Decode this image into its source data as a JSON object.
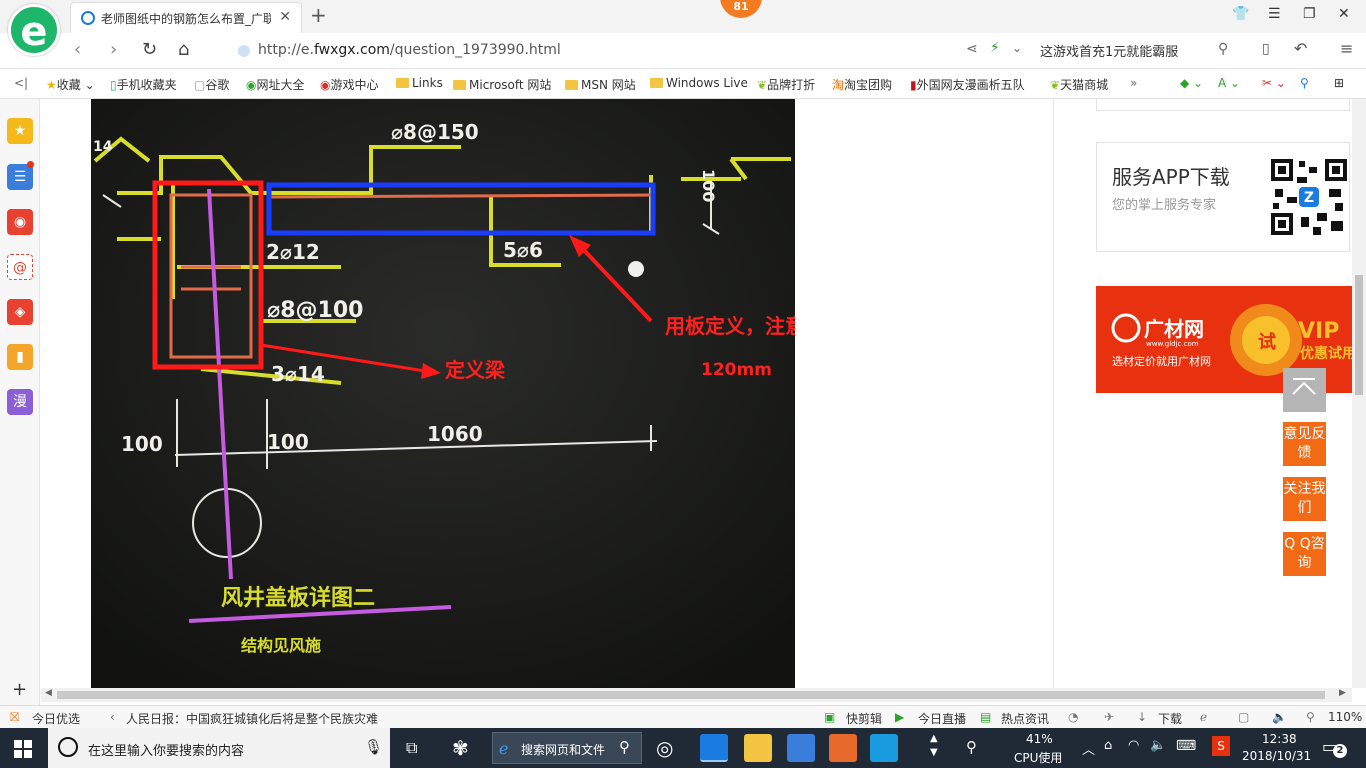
{
  "browser": {
    "tab_title": "老师图纸中的钢筋怎么布置_广联",
    "badge_count": "81",
    "url_prefix": "http://e.",
    "url_domain": "fwxgx.com",
    "url_path": "/question_1973990.html",
    "search_text": "这游戏首充1元就能霸服"
  },
  "bookmarks": [
    {
      "label": "收藏",
      "icon": "star-icon"
    },
    {
      "label": "手机收藏夹",
      "icon": "phone-icon"
    },
    {
      "label": "谷歌",
      "icon": "page-icon"
    },
    {
      "label": "网址大全",
      "icon": "globe-icon"
    },
    {
      "label": "游戏中心",
      "icon": "game-icon"
    },
    {
      "label": "Links",
      "icon": "folder-icon"
    },
    {
      "label": "Microsoft 网站",
      "icon": "folder-icon"
    },
    {
      "label": "MSN 网站",
      "icon": "folder-icon"
    },
    {
      "label": "Windows Live",
      "icon": "folder-icon"
    },
    {
      "label": "品牌打折",
      "icon": "leaf-icon"
    },
    {
      "label": "淘宝团购",
      "icon": "taobao-icon"
    },
    {
      "label": "外国网友漫画析五队",
      "icon": "bookmark-icon"
    },
    {
      "label": "天猫商城",
      "icon": "leaf-icon"
    }
  ],
  "sidebar_icons": [
    "star-icon",
    "news-icon",
    "weibo-icon",
    "mail-icon",
    "game-icon",
    "book-icon",
    "comic-icon"
  ],
  "sidebar_comic_label": "漫",
  "photo": {
    "labels": {
      "top_rebar": "⌀8@150",
      "left_dim": "14",
      "vertical_dim": "100",
      "rebar_2": "2⌀12",
      "rebar_5": "5⌀6",
      "stirrup": "⌀8@100",
      "rebar_3": "3⌀14",
      "dim_left": "100",
      "dim_mid": "100",
      "dim_right": "1060",
      "title": "风井盖板详图二",
      "subtitle": "结构见风施"
    },
    "annotation_slab": "用板定义，注意在左弯折里面输入弯折长度",
    "annotation_length": "120mm",
    "annotation_beam": "定义梁"
  },
  "sidebar_right": {
    "app_title": "服务APP下载",
    "app_desc": "您的掌上服务专家",
    "vip_logo": "广材网",
    "vip_domain": "www.gldjc.com",
    "vip_tagline": "选材定价就用广材网",
    "vip_try": "试",
    "vip_big": "VIP",
    "vip_sub": "优惠试用",
    "feedback": "意见反馈",
    "follow": "关注我们",
    "qq": "Q Q咨询"
  },
  "status_bar": {
    "today": "今日优选",
    "news": "人民日报：中国疯狂城镇化后将是整个民族灾难",
    "kuaijian": "快剪辑",
    "live": "今日直播",
    "hot": "热点资讯",
    "download": "下载",
    "zoom": "110%"
  },
  "taskbar": {
    "search_placeholder": "在这里输入你要搜索的内容",
    "web_search": "搜索网页和文件",
    "cpu_percent": "41%",
    "cpu_label": "CPU使用",
    "time": "12:38",
    "date": "2018/10/31",
    "notifications": "2"
  }
}
